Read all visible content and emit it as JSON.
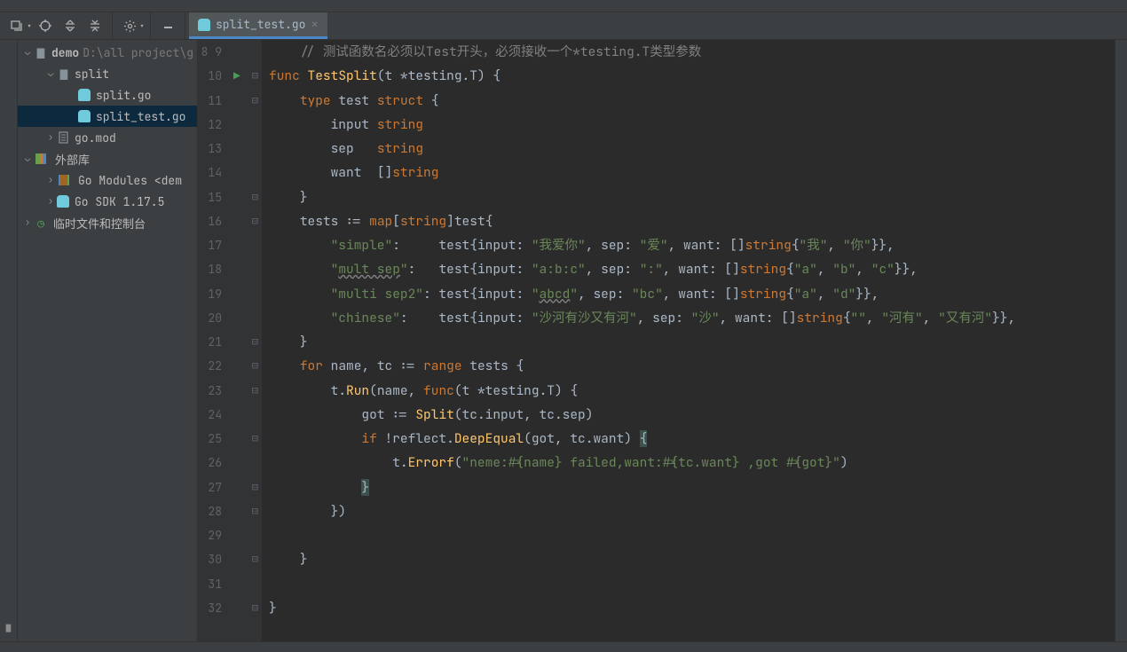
{
  "tab": {
    "filename": "split_test.go"
  },
  "project": {
    "root_name": "demo",
    "root_path": "D:\\all project\\g",
    "nodes": {
      "split_dir": "split",
      "split_go": "split.go",
      "split_test_go": "split_test.go",
      "go_mod": "go.mod",
      "ext_lib": "外部库",
      "go_modules": "Go Modules <dem",
      "go_sdk": "Go SDK 1.17.5",
      "scratches": "临时文件和控制台"
    }
  },
  "gutter": {
    "start": 8,
    "end": 32
  },
  "code": {
    "l8_comment": "// 测试函数名必须以Test开头，必须接收一个*testing.T类型参数",
    "l9_func": "func",
    "l9_name": "TestSplit",
    "l9_sig_t": "t *testing.T",
    "l10_type": "type",
    "l10_test": "test",
    "l10_struct": "struct",
    "l11_field": "input",
    "l11_ty": "string",
    "l12_field": "sep",
    "l12_ty": "string",
    "l13_field": "want",
    "l13_ty": "[]string",
    "l15_tests": "tests",
    "l15_map": "map",
    "l15_string": "string",
    "l15_test": "test",
    "l16_key": "\"simple\"",
    "l16_input": "\"我爱你\"",
    "l16_sep": "\"爱\"",
    "l16_want1": "\"我\"",
    "l16_want2": "\"你\"",
    "l17_key": "mult sep",
    "l17_input": "\"a:b:c\"",
    "l17_sep": "\":\"",
    "l17_w1": "\"a\"",
    "l17_w2": "\"b\"",
    "l17_w3": "\"c\"",
    "l18_key": "\"multi sep2\"",
    "l18_input_txt": "abcd",
    "l18_sep": "\"bc\"",
    "l18_w1": "\"a\"",
    "l18_w2": "\"d\"",
    "l19_key": "\"chinese\"",
    "l19_input": "\"沙河有沙又有河\"",
    "l19_sep": "\"沙\"",
    "l19_w1": "\"\"",
    "l19_w2": "\"河有\"",
    "l19_w3": "\"又有河\"",
    "l21_for": "for",
    "l21_name": "name",
    "l21_tc": "tc",
    "l21_range": "range",
    "l22_run": "Run",
    "l22_func": "func",
    "l22_sig": "t *testing.T",
    "l23_got": "got",
    "l23_split": "Split",
    "l24_if": "if",
    "l24_reflect": "reflect",
    "l24_deepeq": "DeepEqual",
    "l25_errorf": "Errorf",
    "l25_str": "\"neme:#{name} failed,want:#{tc.want} ,got #{got}\"",
    "kw_string": "string",
    "kw_test": "test",
    "field_input": "input",
    "field_sep": "sep",
    "field_want": "want"
  }
}
